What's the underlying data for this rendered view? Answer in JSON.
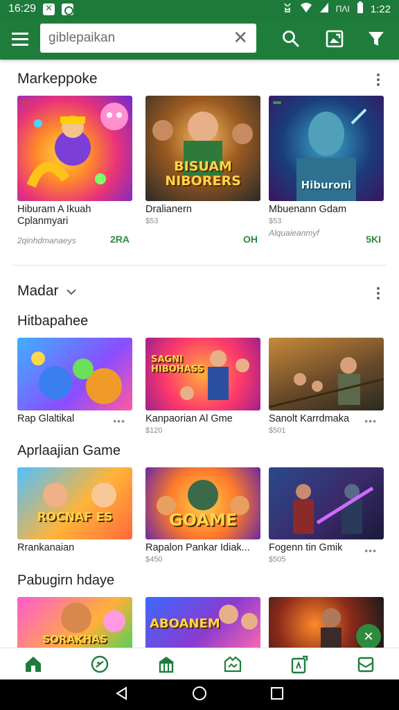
{
  "status_bar": {
    "time_left": "16:29",
    "time_right": "1:22",
    "carrier": "ΠΛΙ"
  },
  "search": {
    "placeholder": "giblepaikan"
  },
  "sections": [
    {
      "title": "Markeppoke",
      "cards": [
        {
          "title": "Hiburam A Ikuah Cplanmyari",
          "sub": "",
          "meta": "2qinhdmanaeys",
          "price": "2RA",
          "badge": "",
          "art": ""
        },
        {
          "title": "Dralianern",
          "sub": "$53",
          "meta": "",
          "price": "OH",
          "badge": "",
          "art": "BISUAM NIBORERS"
        },
        {
          "title": "Mbuenann Gdam",
          "sub": "$53",
          "meta": "Alquaieanmyf",
          "price": "5KI",
          "badge": "",
          "art": "Hiburoni"
        }
      ]
    },
    {
      "title": "Madar",
      "subtitle": "Hitbapahee",
      "cards": [
        {
          "title": "Rap Glaltikal",
          "sub": "",
          "art": ""
        },
        {
          "title": "Kanpaorian Al Gme",
          "sub": "$120",
          "art": "SAGNI HIBOHASS"
        },
        {
          "title": "Sanolt Karrdmaka",
          "sub": "$501",
          "art": ""
        }
      ]
    },
    {
      "title": "Aprlaajian Game",
      "cards": [
        {
          "title": "Rrankanaian",
          "sub": "",
          "art": "ROCNAF ES"
        },
        {
          "title": "Rapalon Pankar Idiak...",
          "sub": "$450",
          "art": "GOAME"
        },
        {
          "title": "Fogenn tin Gmik",
          "sub": "$505",
          "art": ""
        }
      ]
    },
    {
      "title": "Pabugirn hdaye",
      "cards": [
        {
          "title": "",
          "art": "SORAKHAS"
        },
        {
          "title": "",
          "art": "ABOANEM"
        },
        {
          "title": "",
          "art": ""
        }
      ]
    }
  ],
  "colors": {
    "brand_green": "#1f7d3b",
    "accent_green": "#2e8b3e"
  }
}
